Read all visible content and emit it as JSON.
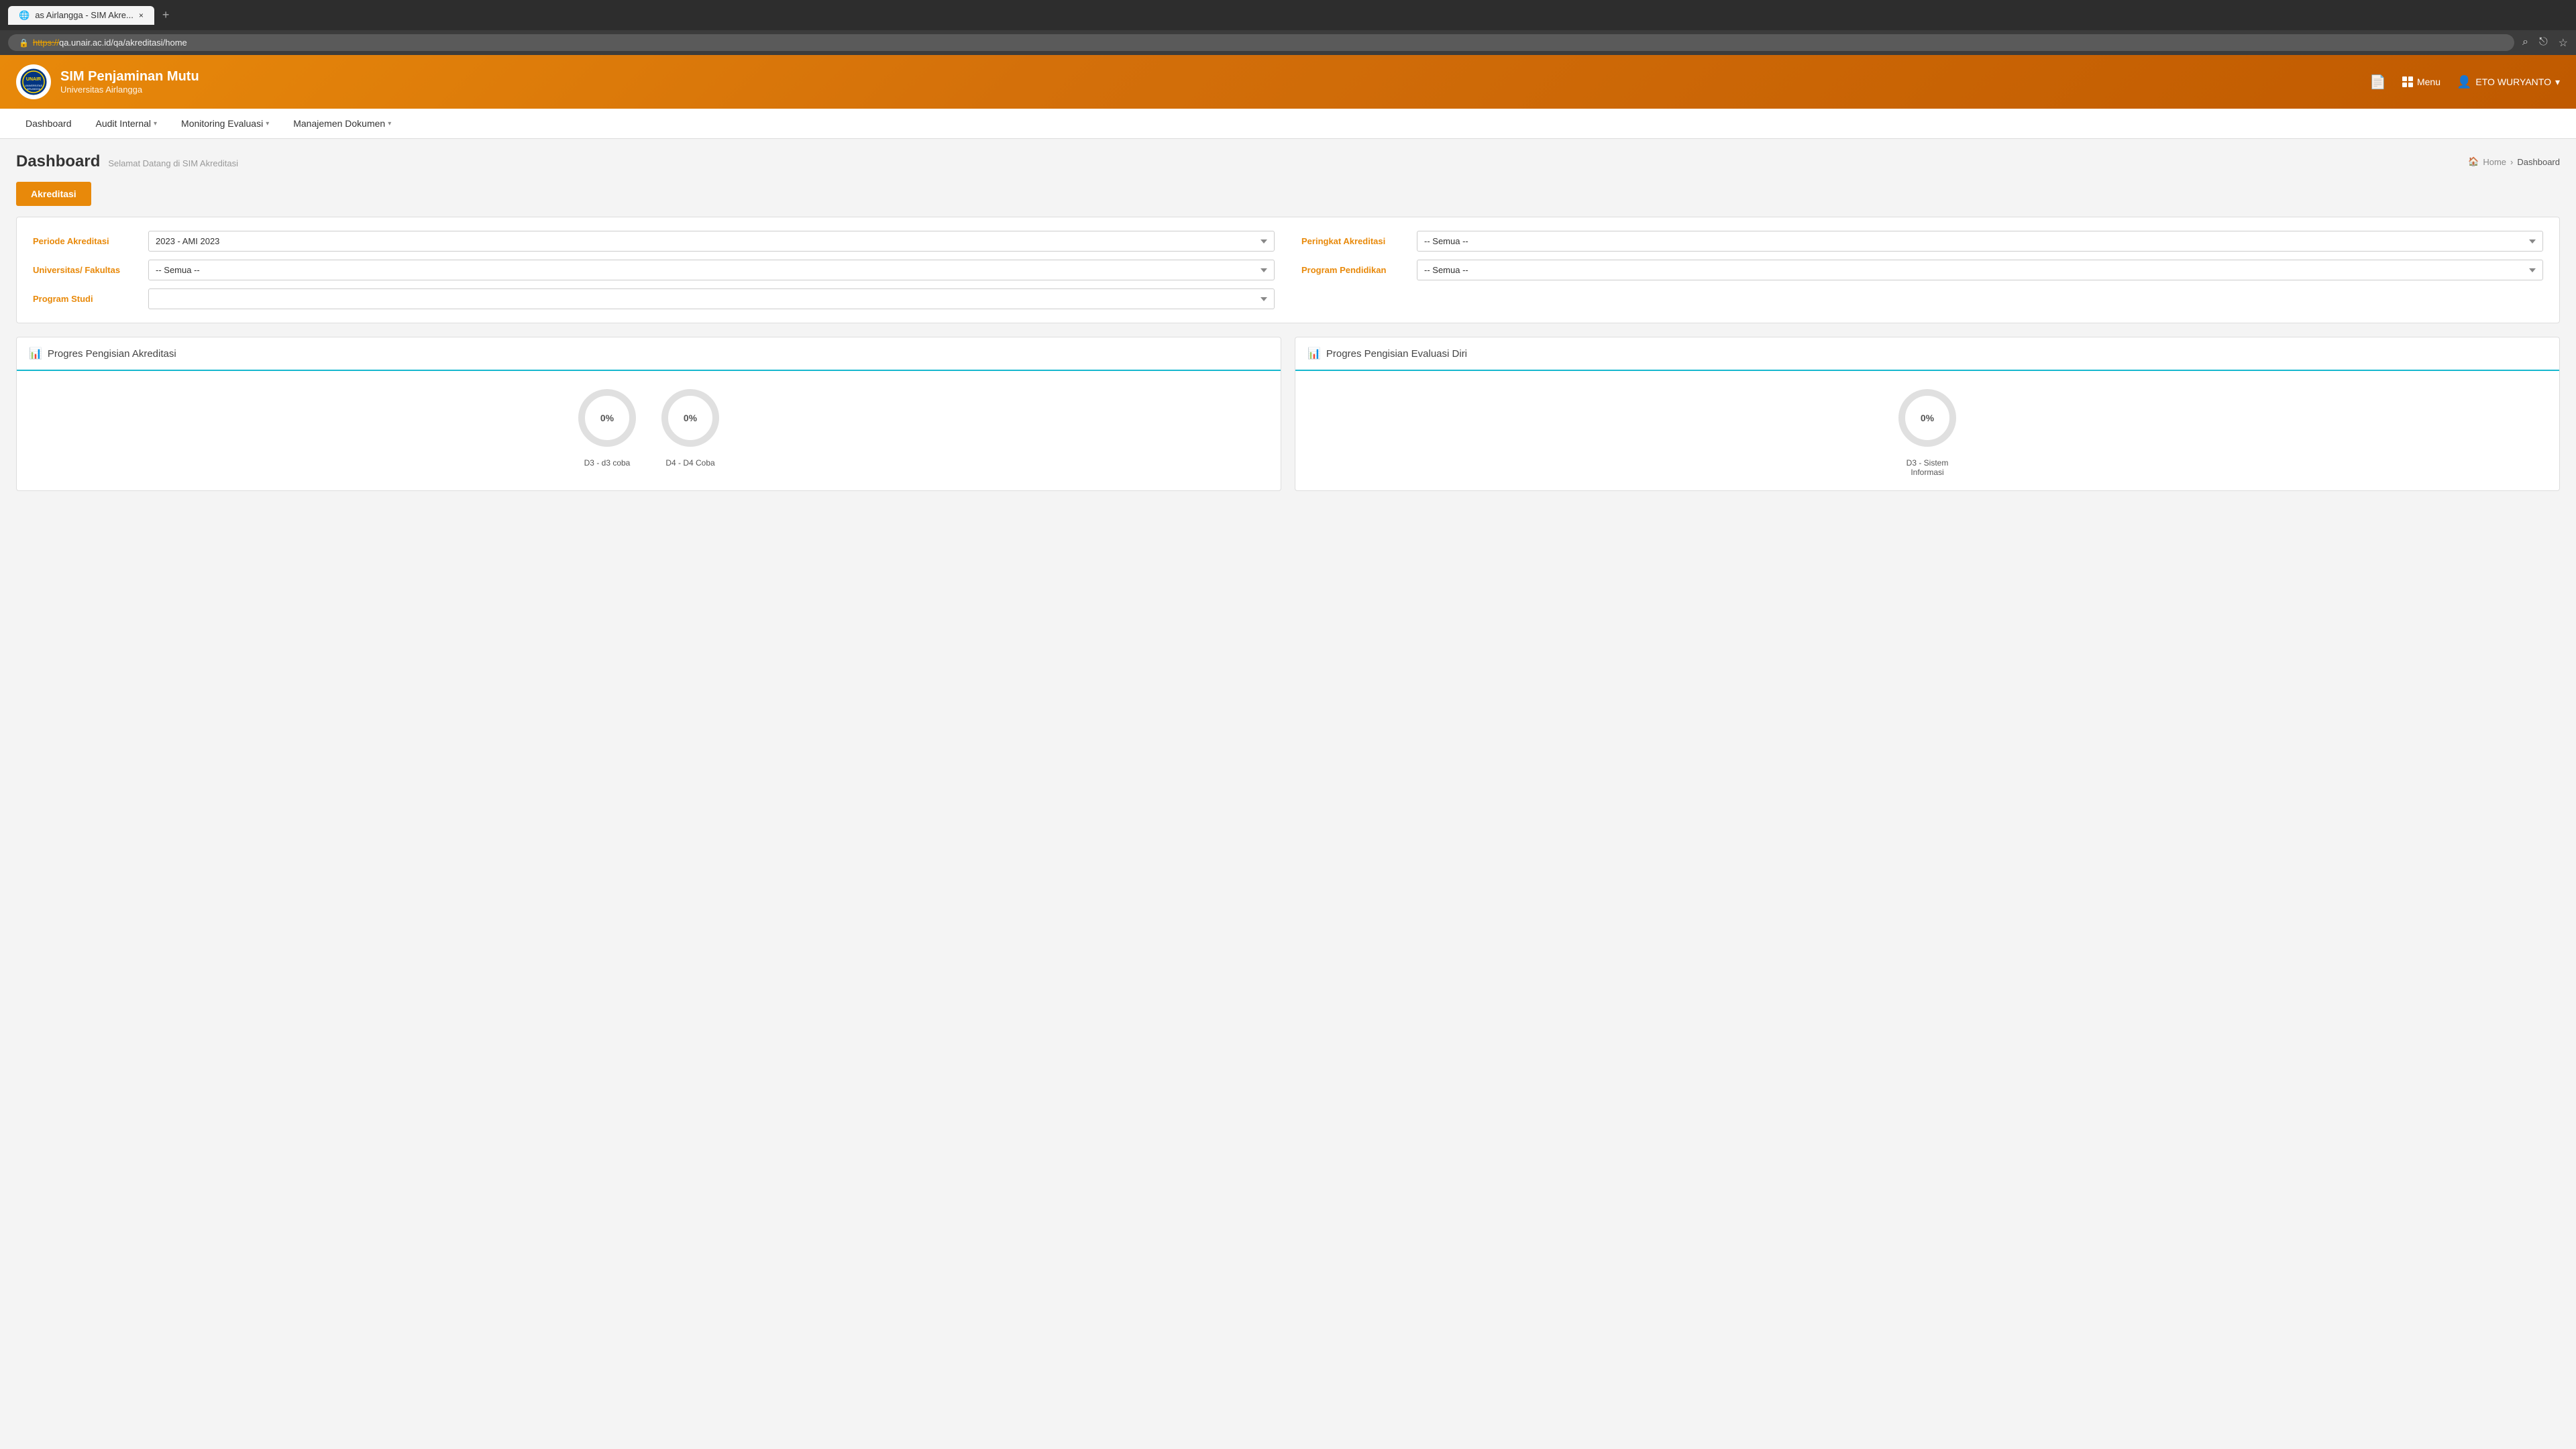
{
  "browser": {
    "tab_title": "as Airlangga - SIM Akre...",
    "tab_close": "×",
    "tab_new": "+",
    "address": {
      "secure_icon": "🔒",
      "https_text": "https://",
      "url_text": "qa.unair.ac.id/qa/akreditasi/home",
      "full_url": "https://qa.unair.ac.id/qa/akreditasi/home"
    },
    "actions": {
      "search": "⌕",
      "share": "⎋",
      "bookmark": "☆"
    }
  },
  "header": {
    "logo_text": "🏛",
    "app_name": "SIM Penjaminan Mutu",
    "university": "Universitas Airlangga",
    "menu_label": "Menu",
    "user_label": "ETO WURYANTO",
    "user_dropdown": "▾",
    "doc_icon": "📄"
  },
  "nav": {
    "items": [
      {
        "label": "Dashboard",
        "has_dropdown": false
      },
      {
        "label": "Audit Internal",
        "has_dropdown": true
      },
      {
        "label": "Monitoring Evaluasi",
        "has_dropdown": true
      },
      {
        "label": "Manajemen Dokumen",
        "has_dropdown": true
      }
    ]
  },
  "page": {
    "title": "Dashboard",
    "subtitle": "Selamat Datang di SIM Akreditasi",
    "breadcrumb_home": "Home",
    "breadcrumb_sep": "›",
    "breadcrumb_current": "Dashboard"
  },
  "tabs": {
    "active_label": "Akreditasi"
  },
  "filters": {
    "periode_label": "Periode Akreditasi",
    "periode_value": "2023 - AMI 2023",
    "peringkat_label": "Peringkat Akreditasi",
    "peringkat_value": "-- Semua --",
    "universitas_label": "Universitas/ Fakultas",
    "universitas_value": "-- Semua --",
    "program_pendidikan_label": "Program Pendidikan",
    "program_pendidikan_value": "-- Semua --",
    "program_studi_label": "Program Studi",
    "program_studi_value": ""
  },
  "charts": {
    "left": {
      "title": "Progres Pengisian Akreditasi",
      "items": [
        {
          "label": "D3 - d3 coba",
          "value": "0%"
        },
        {
          "label": "D4 - D4 Coba",
          "value": "0%"
        }
      ]
    },
    "right": {
      "title": "Progres Pengisian Evaluasi Diri",
      "items": [
        {
          "label": "D3 - Sistem Informasi",
          "value": "0%"
        }
      ]
    }
  }
}
